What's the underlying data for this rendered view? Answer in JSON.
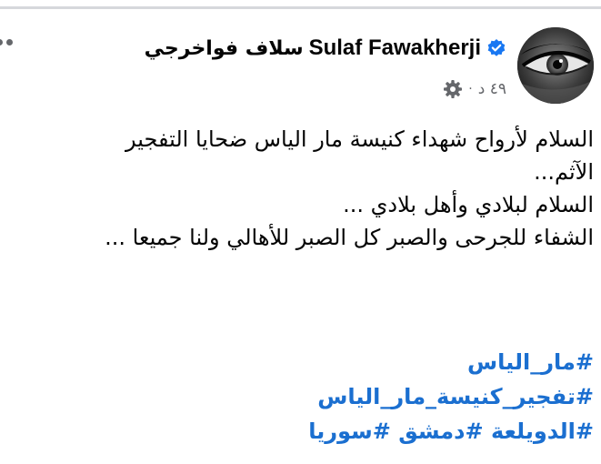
{
  "post": {
    "author": {
      "name_latin": "Sulaf Fawakherji",
      "name_arabic": "سلاف فواخرجي",
      "avatar_icon": "woman-eye-avatar",
      "verified_icon": "verified-badge-icon"
    },
    "meta": {
      "time": "٤٩ د",
      "separator": "·",
      "audience_icon": "gear-icon"
    },
    "body": [
      "السلام لأرواح شهداء كنيسة مار الياس ضحايا التفجير",
      "الآثم...",
      "السلام لبلادي وأهل بلادي ...",
      "الشفاء للجرحى والصبر كل الصبر للأهالي ولنا جميعا ..."
    ],
    "hashtag_lines": [
      [
        "#مار_الياس"
      ],
      [
        "#تفجير_كنيسة_مار_الياس"
      ],
      [
        "#الدويلعة",
        "#دمشق",
        "#سوريا"
      ]
    ],
    "more_icon": "more-options-icon"
  },
  "colors": {
    "text": "#050505",
    "meta": "#65676b",
    "hashtag": "#1b6fd0",
    "verified": "#1877f2"
  }
}
